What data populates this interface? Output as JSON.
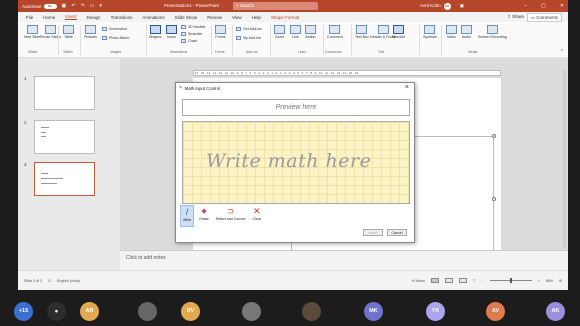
{
  "titlebar": {
    "autosave": "AutoSave",
    "autosave_state": "On",
    "doc_title": "Presentation1 - PowerPoint",
    "search": "Search",
    "user_name": "Avrit Kohn",
    "user_initials": "AK"
  },
  "tabs": [
    "File",
    "Home",
    "Insert",
    "Design",
    "Transitions",
    "Animations",
    "Slide Show",
    "Review",
    "View",
    "Help",
    "Shape Format"
  ],
  "active_tab": "Insert",
  "share": "Share",
  "comments": "Comments",
  "ribbon": {
    "new_slide": "New Slide",
    "reuse_slides": "Reuse Slides",
    "table": "Table",
    "pictures": "Pictures",
    "screenshot": "Screenshot",
    "photo_album": "Photo Album",
    "shapes": "Shapes",
    "icons": "Icons",
    "models_3d": "3D Models",
    "smartart": "SmartArt",
    "chart": "Chart",
    "forms": "Forms",
    "get_addins": "Get Add-ins",
    "my_addins": "My Add-ins",
    "zoom": "Zoom",
    "link": "Link",
    "action": "Action",
    "comment": "Comment",
    "text_box": "Text Box",
    "header_footer": "Header & Footer",
    "wordart": "WordArt",
    "symbols": "Symbols",
    "video": "Video",
    "audio": "Audio",
    "screen_recording": "Screen Recording",
    "groups": {
      "slides": "Slides",
      "tables": "Tables",
      "images": "Images",
      "illustrations": "Illustrations",
      "forms": "Forms",
      "addins": "Add-ins",
      "links": "Links",
      "comments": "Comments",
      "text": "Text",
      "media": "Media"
    }
  },
  "slides": [
    {
      "num": "1"
    },
    {
      "num": "2"
    },
    {
      "num": "3"
    }
  ],
  "notes_placeholder": "Click to add notes",
  "status": {
    "slide_info": "Slide 3 of 3",
    "language": "English (India)",
    "notes": "Notes",
    "zoom": "66%"
  },
  "dialog": {
    "title": "Math Input Control",
    "preview": "Preview here",
    "write_hint": "Write math here",
    "tools": [
      {
        "label": "Write",
        "glyph": "/"
      },
      {
        "label": "Erase",
        "glyph": "◆"
      },
      {
        "label": "Select and Correct",
        "glyph": "⊃"
      },
      {
        "label": "Clear",
        "glyph": "✕"
      }
    ],
    "insert": "Insert",
    "cancel": "Cancel"
  },
  "meeting": [
    {
      "initials": "+15",
      "color": "#3a6fd0"
    },
    {
      "initials": "•",
      "color": "#2d2d2d"
    },
    {
      "initials": "AR",
      "color": "#e2a94f"
    },
    {
      "initials": "",
      "color": "#666666"
    },
    {
      "initials": "RV",
      "color": "#e2a94f"
    },
    {
      "initials": "",
      "color": "#777777"
    },
    {
      "initials": "",
      "color": "#5a4a3a"
    },
    {
      "initials": "MK",
      "color": "#6f72cf"
    },
    {
      "initials": "YK",
      "color": "#a9a6ee"
    },
    {
      "initials": "AV",
      "color": "#e07a4f"
    },
    {
      "initials": "AK",
      "color": "#9b8fe0"
    }
  ]
}
